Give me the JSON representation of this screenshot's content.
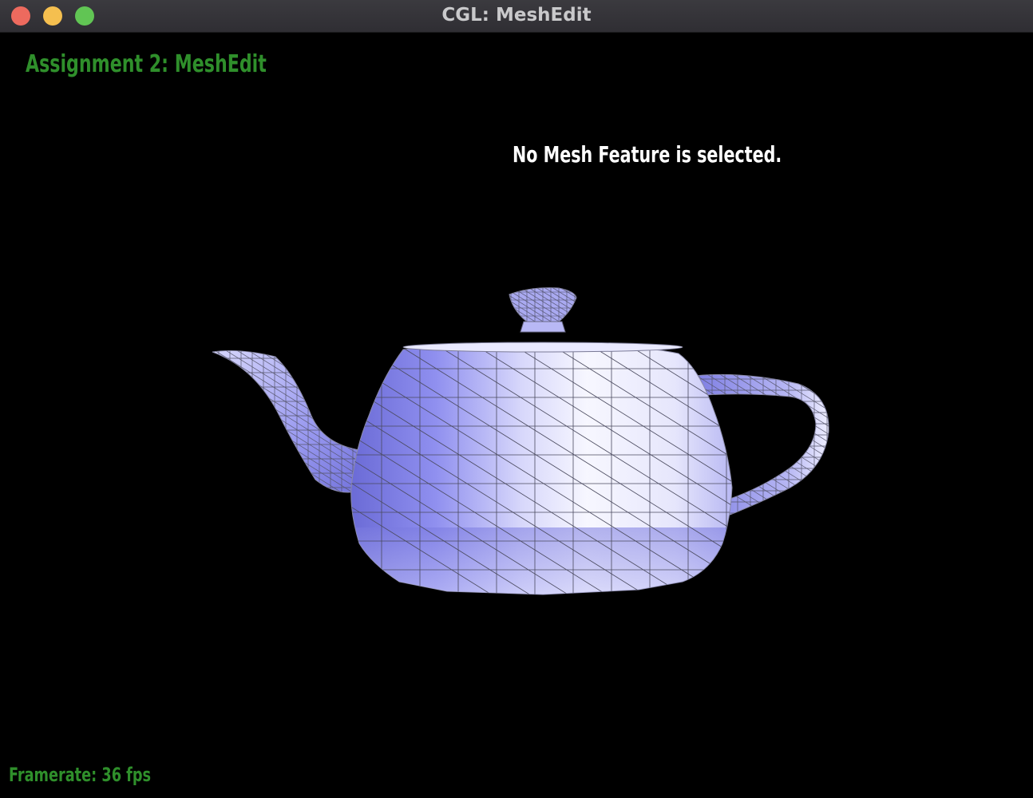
{
  "window": {
    "title": "CGL: MeshEdit",
    "buttons": [
      "close",
      "minimize",
      "zoom"
    ]
  },
  "hud": {
    "app_title": "Assignment 2: MeshEdit",
    "selection_status": "No Mesh Feature is selected.",
    "framerate": "Framerate: 36 fps"
  },
  "scene": {
    "model": "teapot-mesh",
    "render_mode": "shaded-wireframe",
    "colors": {
      "background": "#000000",
      "mesh_light": "#f2f2ff",
      "mesh_mid": "#a6a6f2",
      "mesh_dark": "#6b6bd6",
      "wire": "#3a3a4a",
      "hud_green": "#2f8f2b",
      "hud_white": "#ffffff"
    }
  }
}
